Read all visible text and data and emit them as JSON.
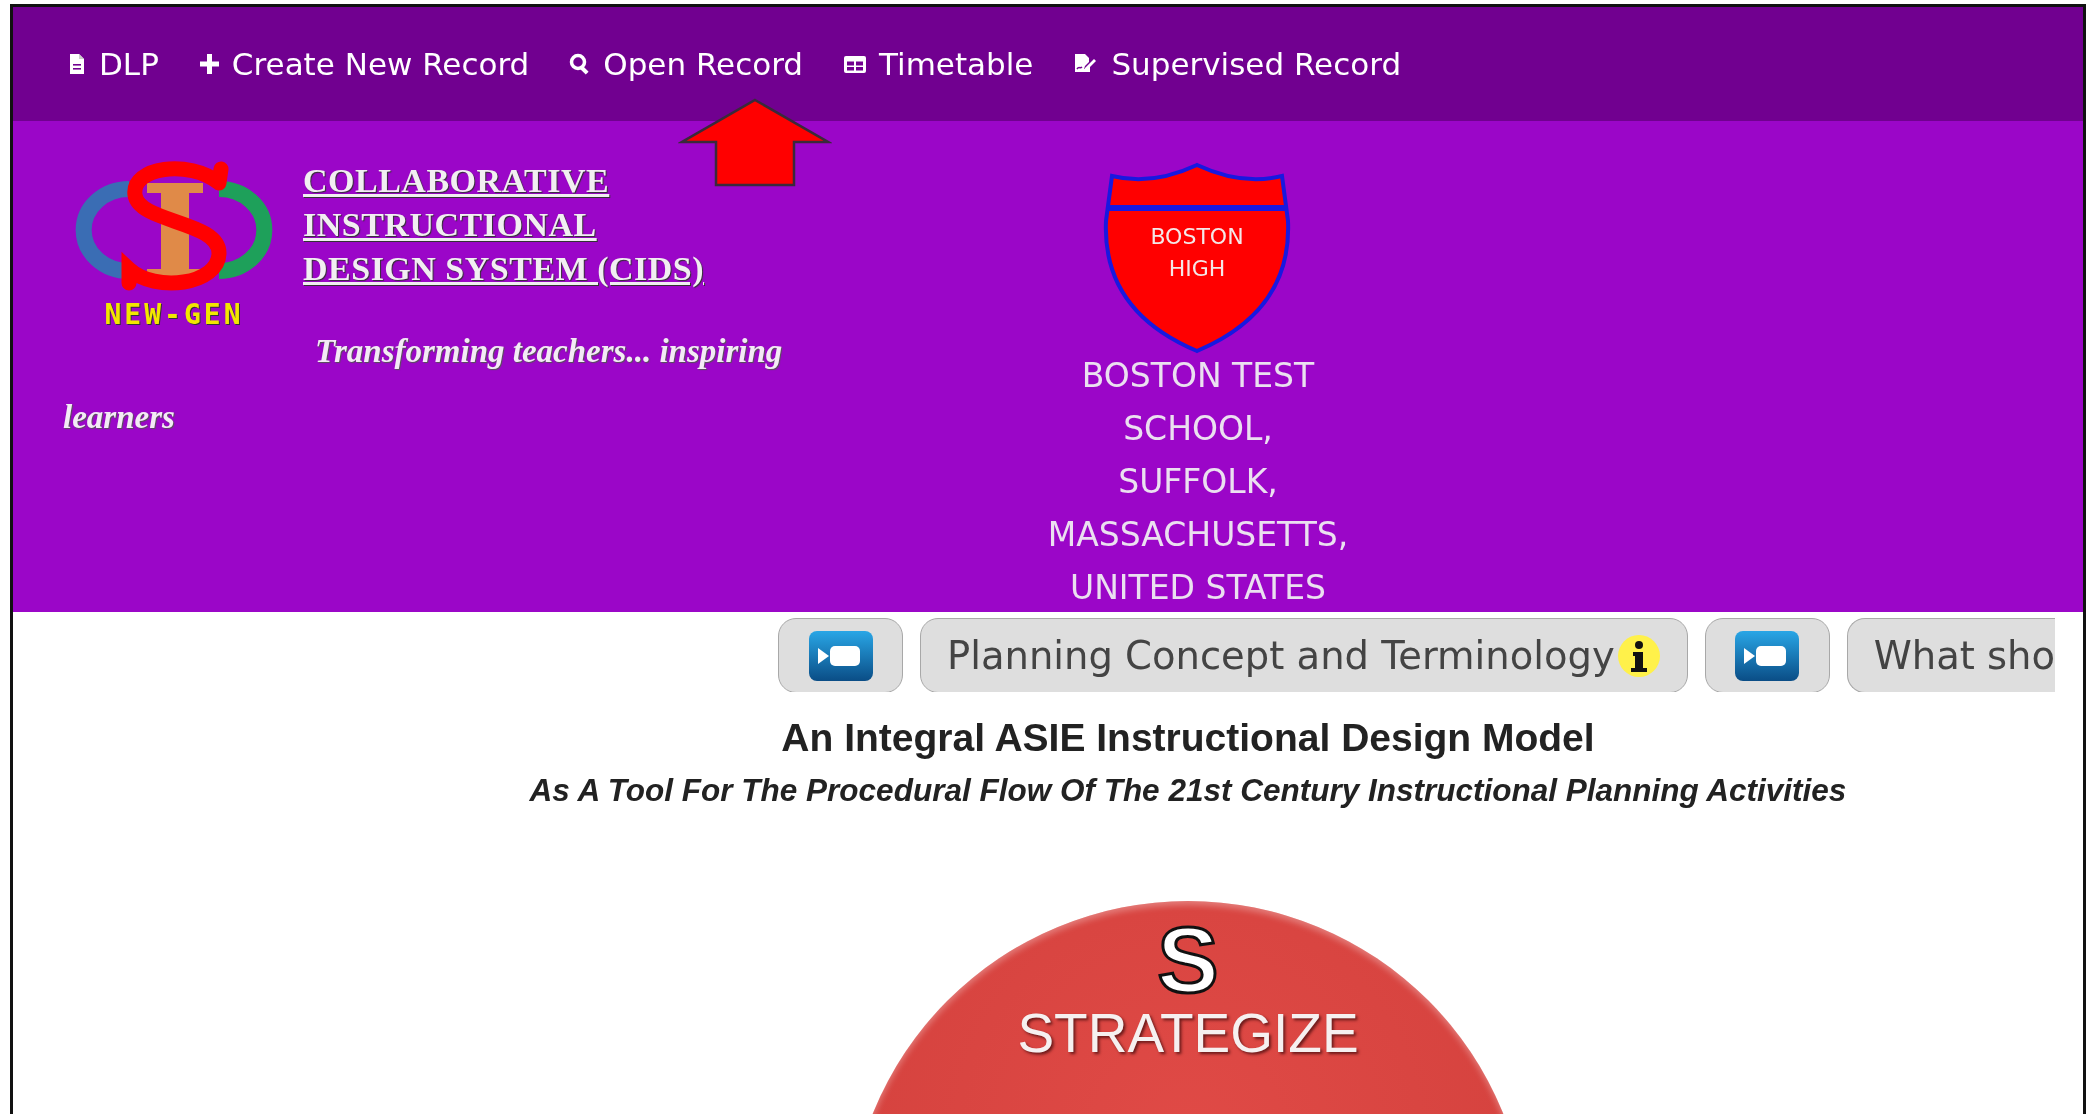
{
  "nav": [
    {
      "label": "DLP"
    },
    {
      "label": "Create New Record"
    },
    {
      "label": "Open Record"
    },
    {
      "label": "Timetable"
    },
    {
      "label": "Supervised Record"
    }
  ],
  "header": {
    "logo": {
      "caption": "NEW-GEN"
    },
    "title_lines": [
      "COLLABORATIVE",
      "INSTRUCTIONAL",
      "DESIGN SYSTEM (CIDS)"
    ],
    "tagline": "Transforming teachers... inspiring learners",
    "badge_lines": [
      "BOSTON",
      "HIGH"
    ],
    "school_lines": [
      "BOSTON TEST",
      "SCHOOL,",
      "SUFFOLK,",
      "MASSACHUSETTS,",
      "UNITED STATES"
    ]
  },
  "toolbar": [
    {
      "kind": "video"
    },
    {
      "kind": "label",
      "label": "Planning Concept and Terminology",
      "info": true
    },
    {
      "kind": "video"
    },
    {
      "kind": "label",
      "label": "What sho",
      "info": false
    }
  ],
  "model": {
    "title": "An Integral ASIE Instructional Design Model",
    "subtitle": "As A Tool For The Procedural Flow Of The 21st Century Instructional Planning Activities",
    "letter": "S",
    "stage": "STRATEGIZE"
  }
}
